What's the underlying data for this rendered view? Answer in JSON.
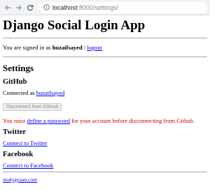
{
  "browser": {
    "url_host": "localhost",
    "url_path": ":8000/settings/"
  },
  "page": {
    "title": "Django Social Login App",
    "signed_in_prefix": "You are signed in as",
    "username": "huzaifsayed",
    "separator": "/",
    "logout_link": "logout",
    "settings_heading": "Settings"
  },
  "github": {
    "heading": "GitHub",
    "connected_prefix": "Connected as",
    "connected_user": "huzaifsayed",
    "disconnect_button": "Disconnect from GitHub",
    "warning_prefix": "You must",
    "warning_link": "define a password",
    "warning_suffix": "for your account before disconnecting from Github."
  },
  "twitter": {
    "heading": "Twitter",
    "connect_link": "Connect to Twitter"
  },
  "facebook": {
    "heading": "Facebook",
    "connect_link": "Connect to Facebook"
  },
  "footer": {
    "link": "studygyaan.com"
  }
}
